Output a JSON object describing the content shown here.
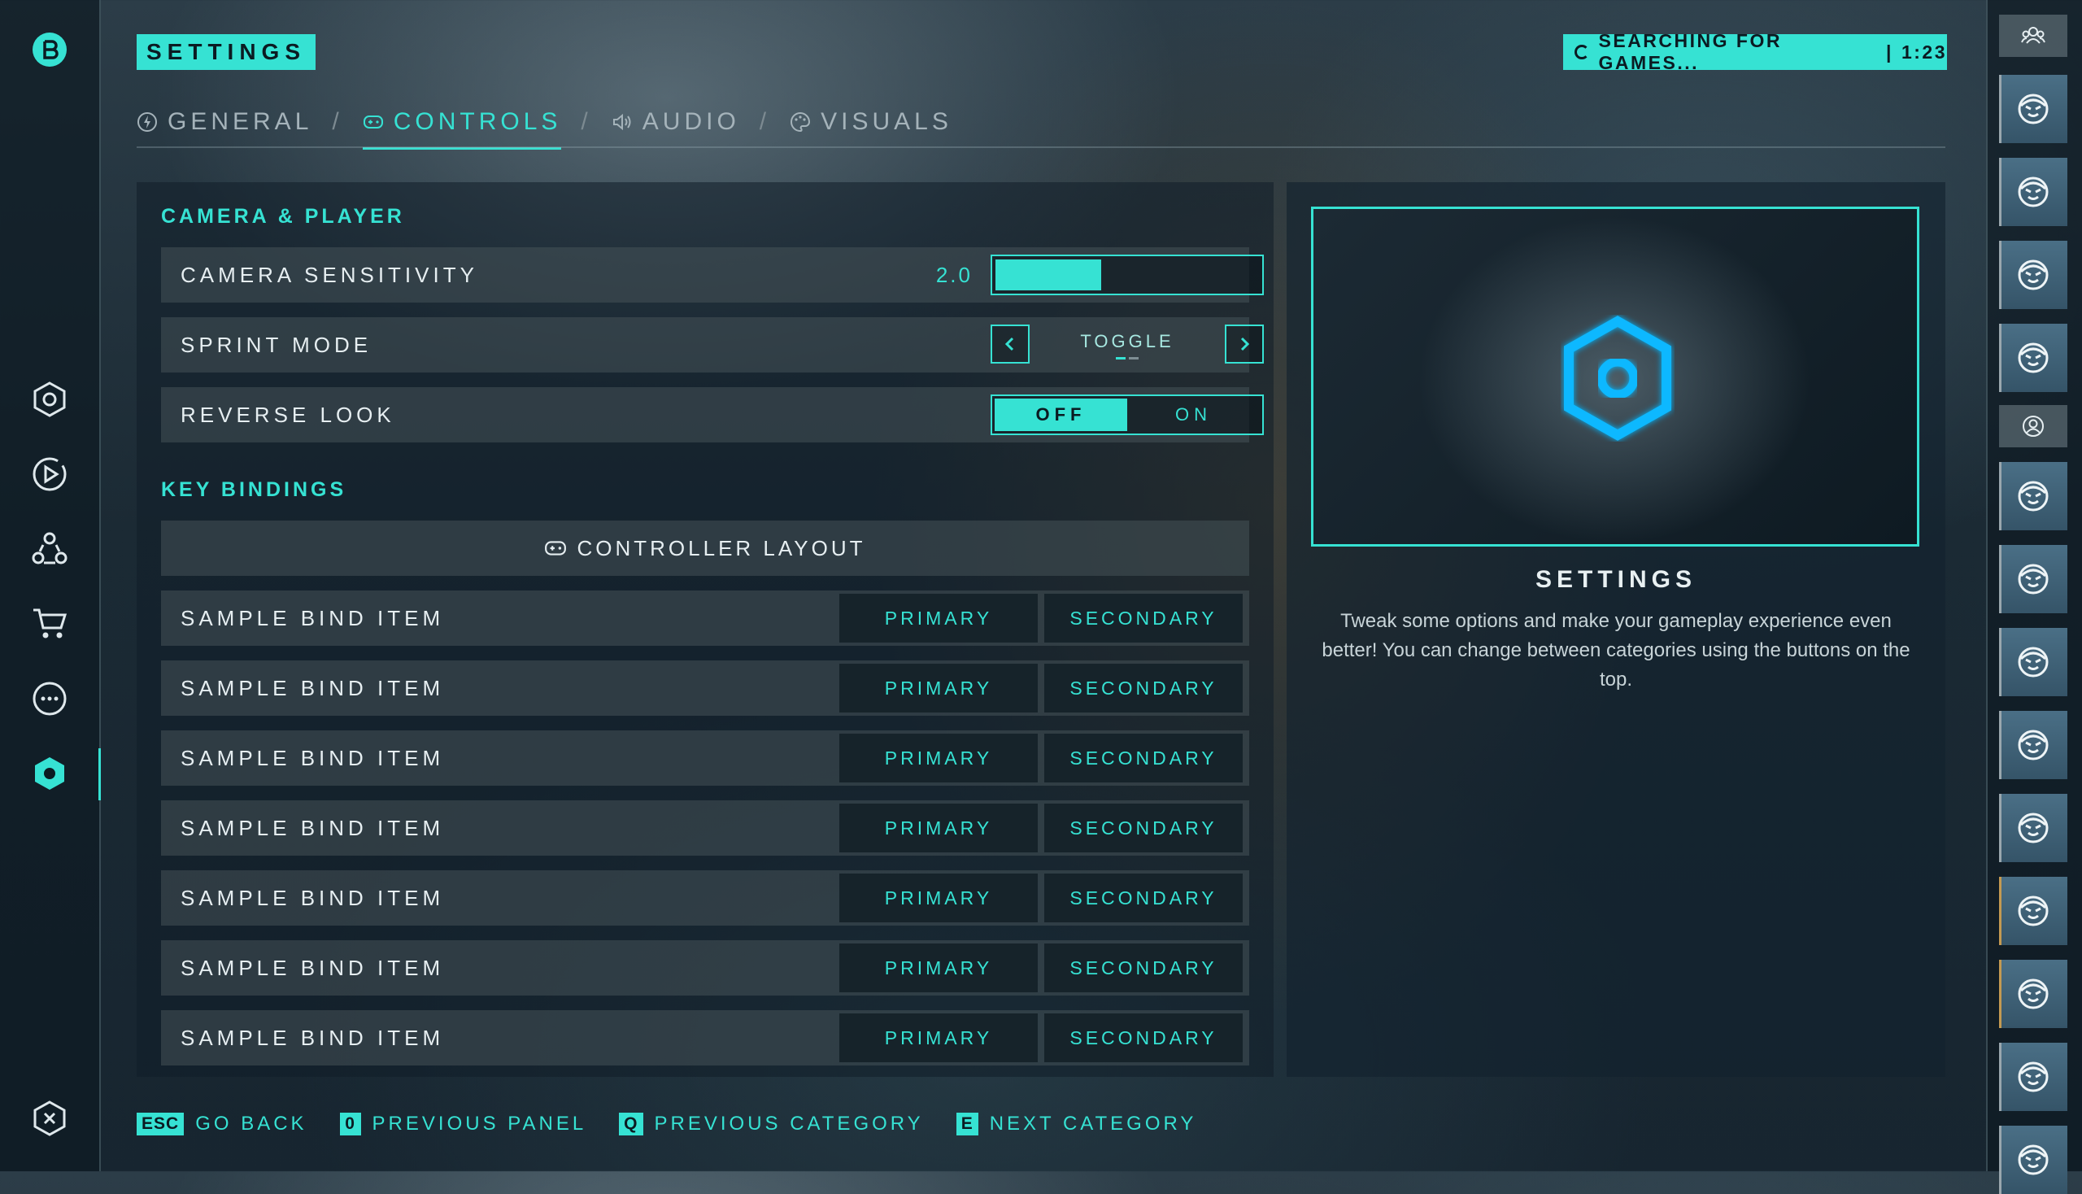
{
  "header": {
    "title": "SETTINGS",
    "matchmaking": {
      "status": "SEARCHING FOR GAMES...",
      "separator": "|",
      "timer": "1:23"
    }
  },
  "tabs": [
    {
      "label": "GENERAL",
      "icon": "bolt-icon",
      "active": false
    },
    {
      "label": "CONTROLS",
      "icon": "gamepad-icon",
      "active": true
    },
    {
      "label": "AUDIO",
      "icon": "speaker-icon",
      "active": false
    },
    {
      "label": "VISUALS",
      "icon": "palette-icon",
      "active": false
    }
  ],
  "tab_separator": "/",
  "camera_player": {
    "title": "CAMERA & PLAYER",
    "camera_sensitivity": {
      "label": "CAMERA SENSITIVITY",
      "value": "2.0",
      "fill_fraction": 0.4
    },
    "sprint_mode": {
      "label": "SPRINT MODE",
      "value": "TOGGLE",
      "option_index": 0,
      "option_count": 2
    },
    "reverse_look": {
      "label": "REVERSE LOOK",
      "off_label": "OFF",
      "on_label": "ON",
      "selected": "OFF"
    }
  },
  "key_bindings": {
    "title": "KEY BINDINGS",
    "controller_layout_label": "CONTROLLER LAYOUT",
    "items": [
      {
        "label": "SAMPLE BIND ITEM",
        "primary": "PRIMARY",
        "secondary": "SECONDARY"
      },
      {
        "label": "SAMPLE BIND ITEM",
        "primary": "PRIMARY",
        "secondary": "SECONDARY"
      },
      {
        "label": "SAMPLE BIND ITEM",
        "primary": "PRIMARY",
        "secondary": "SECONDARY"
      },
      {
        "label": "SAMPLE BIND ITEM",
        "primary": "PRIMARY",
        "secondary": "SECONDARY"
      },
      {
        "label": "SAMPLE BIND ITEM",
        "primary": "PRIMARY",
        "secondary": "SECONDARY"
      },
      {
        "label": "SAMPLE BIND ITEM",
        "primary": "PRIMARY",
        "secondary": "SECONDARY"
      },
      {
        "label": "SAMPLE BIND ITEM",
        "primary": "PRIMARY",
        "secondary": "SECONDARY"
      }
    ]
  },
  "info_panel": {
    "title": "SETTINGS",
    "description": "Tweak some options and make your gameplay experience even better! You can change between categories using the buttons on the top.",
    "icon": "hexagon-settings-icon"
  },
  "footer_hints": [
    {
      "key": "ESC",
      "label": "GO BACK"
    },
    {
      "key": "0",
      "label": "PREVIOUS PANEL"
    },
    {
      "key": "Q",
      "label": "PREVIOUS CATEGORY"
    },
    {
      "key": "E",
      "label": "NEXT CATEGORY"
    }
  ],
  "left_rail": {
    "logo": "brand-logo-icon",
    "items": [
      "home-icon",
      "play-icon",
      "community-icon",
      "cart-icon",
      "more-icon",
      "settings-icon"
    ],
    "active": "settings-icon",
    "bottom": "exit-icon"
  },
  "right_rail": {
    "headers": [
      "friends-group-icon",
      "profile-icon"
    ],
    "friend_avatars": 14
  },
  "colors": {
    "accent": "#36e2d3",
    "dark_text": "#0b1b22",
    "away_status": "#c49a52"
  }
}
